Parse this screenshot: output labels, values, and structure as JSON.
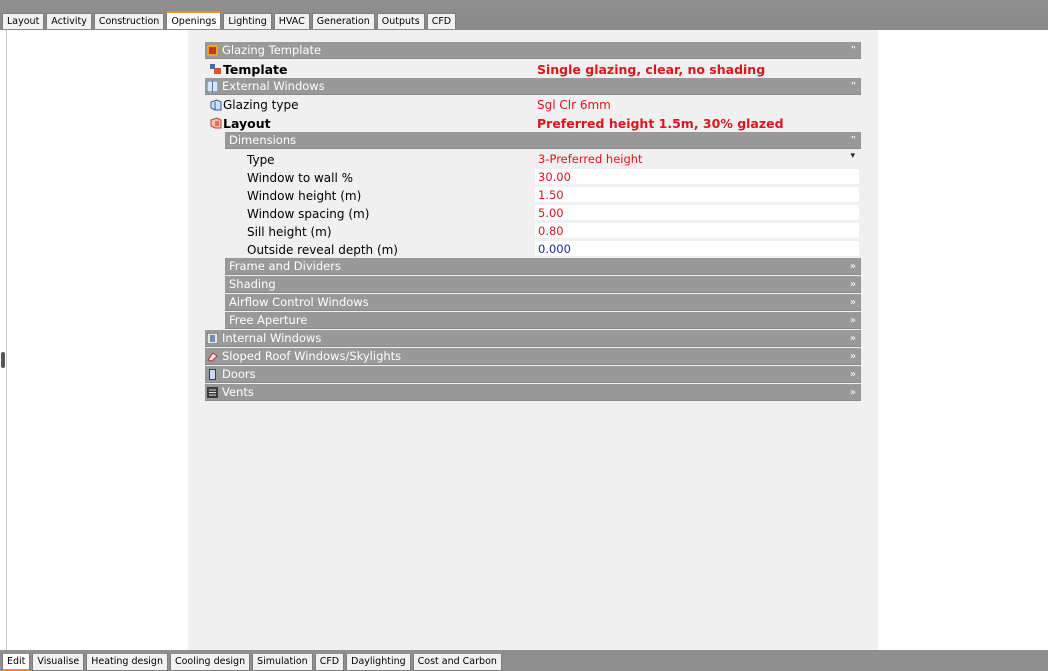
{
  "top_tabs": [
    "Layout",
    "Activity",
    "Construction",
    "Openings",
    "Lighting",
    "HVAC",
    "Generation",
    "Outputs",
    "CFD"
  ],
  "active_top_tab": "Openings",
  "bottom_tabs": [
    "Edit",
    "Visualise",
    "Heating design",
    "Cooling design",
    "Simulation",
    "CFD",
    "Daylighting",
    "Cost and Carbon"
  ],
  "active_bottom_tab": "Edit",
  "glazing_template": {
    "header": "Glazing Template",
    "template_label": "Template",
    "template_value": "Single glazing, clear, no shading"
  },
  "external_windows": {
    "header": "External Windows",
    "glazing_type_label": "Glazing type",
    "glazing_type_value": "Sgl Clr 6mm",
    "layout_label": "Layout",
    "layout_value": "Preferred height 1.5m, 30% glazed"
  },
  "dimensions": {
    "header": "Dimensions",
    "type_label": "Type",
    "type_value": "3-Preferred height",
    "wwr_label": "Window to wall %",
    "wwr_value": "30.00",
    "height_label": "Window height (m)",
    "height_value": "1.50",
    "spacing_label": "Window spacing (m)",
    "spacing_value": "5.00",
    "sill_label": "Sill height (m)",
    "sill_value": "0.80",
    "reveal_label": "Outside reveal depth (m)",
    "reveal_value": "0.000"
  },
  "collapsed_subsections": [
    "Frame and Dividers",
    "Shading",
    "Airflow Control Windows",
    "Free Aperture"
  ],
  "collapsed_sections": [
    "Internal Windows",
    "Sloped Roof Windows/Skylights",
    "Doors",
    "Vents"
  ],
  "glyphs": {
    "expanded": "»",
    "collapsed": "»",
    "open_section": "≡",
    "dropdown": "▾"
  },
  "colors": {
    "accent": "#f08a24",
    "value_red": "#e0141e",
    "value_blue": "#1a2aa8",
    "header_grey": "#999999"
  }
}
